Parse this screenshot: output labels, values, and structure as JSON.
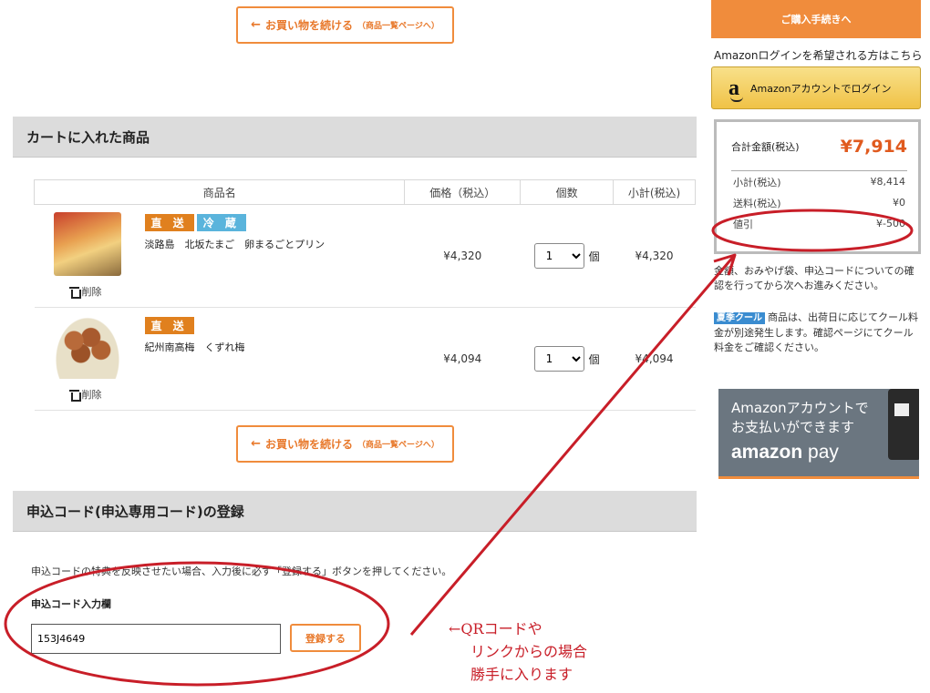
{
  "continue_button": {
    "arrow": "←",
    "label": "お買い物を続ける",
    "sub": "（商品一覧ページへ）"
  },
  "cart_section": {
    "title": "カートに入れた商品"
  },
  "table": {
    "headers": [
      "商品名",
      "価格（税込）",
      "個数",
      "小計(税込)"
    ],
    "rows": [
      {
        "badges": [
          "直 送",
          "冷 蔵"
        ],
        "name": "淡路島　北坂たまご　卵まるごとプリン",
        "price": "¥4,320",
        "qty": "1",
        "unit": "個",
        "subtotal": "¥4,320",
        "delete": "削除"
      },
      {
        "badges": [
          "直 送"
        ],
        "name": "紀州南高梅　くずれ梅",
        "price": "¥4,094",
        "qty": "1",
        "unit": "個",
        "subtotal": "¥4,094",
        "delete": "削除"
      }
    ]
  },
  "code_section": {
    "title": "申込コード(申込専用コード)の登録",
    "note": "申込コードの特典を反映させたい場合、入力後に必ず「登録する」ボタンを押してください。",
    "input_label": "申込コード入力欄",
    "input_value": "153J4649",
    "register_label": "登録する"
  },
  "annotation": {
    "lines": [
      "←QRコードや",
      "リンクからの場合",
      "勝手に入ります"
    ],
    "color": "#c81e28"
  },
  "sidebar": {
    "checkout_label": "ご購入手続きへ",
    "amazon_hint": "Amazonログインを希望される方はこちら",
    "amazon_logo": "a",
    "amazon_button": "Amazonアカウントでログイン",
    "summary": {
      "total_label": "合計金額(税込)",
      "total_value": "¥7,914",
      "rows": [
        {
          "label": "小計(税込)",
          "value": "¥8,414"
        },
        {
          "label": "送料(税込)",
          "value": "¥0"
        },
        {
          "label": "値引",
          "value": "¥-500"
        }
      ]
    },
    "note1": "金額、おみやげ袋、申込コードについての確認を行ってから次へお進みください。",
    "cool_badge": "夏季クール",
    "note2": "商品は、出荷日に応じてクール料金が別途発生します。確認ページにてクール料金をご確認ください。",
    "amazon_pay": {
      "line1": "Amazonアカウントで",
      "line2": "お支払いができます",
      "logo_main": "amazon",
      "logo_pay": " pay"
    }
  },
  "colors": {
    "accent": "#f08c3c",
    "total": "#e05a1e",
    "annotation": "#c81e28"
  }
}
